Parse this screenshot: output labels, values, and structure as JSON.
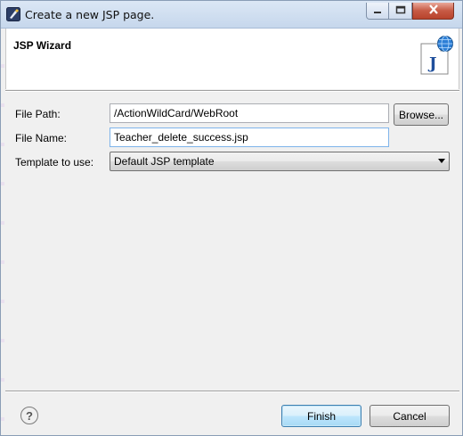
{
  "window": {
    "title": "Create a new JSP page.",
    "app_icon": "eclipse-wizard-icon",
    "controls": [
      "minimize-icon",
      "maximize-icon",
      "close-icon"
    ]
  },
  "banner": {
    "title": "JSP Wizard",
    "icon_letter": "J"
  },
  "form": {
    "file_path": {
      "label": "File Path:",
      "value": "/ActionWildCard/WebRoot"
    },
    "browse_label": "Browse...",
    "file_name": {
      "label": "File Name:",
      "value": "Teacher_delete_success.jsp"
    },
    "template": {
      "label": "Template to use:",
      "selected": "Default JSP template"
    }
  },
  "footer": {
    "help_symbol": "?",
    "finish_label": "Finish",
    "cancel_label": "Cancel"
  },
  "colors": {
    "close_button": "#c75a44",
    "default_button": "#a7d9f5",
    "banner_background": "#ffffff"
  }
}
